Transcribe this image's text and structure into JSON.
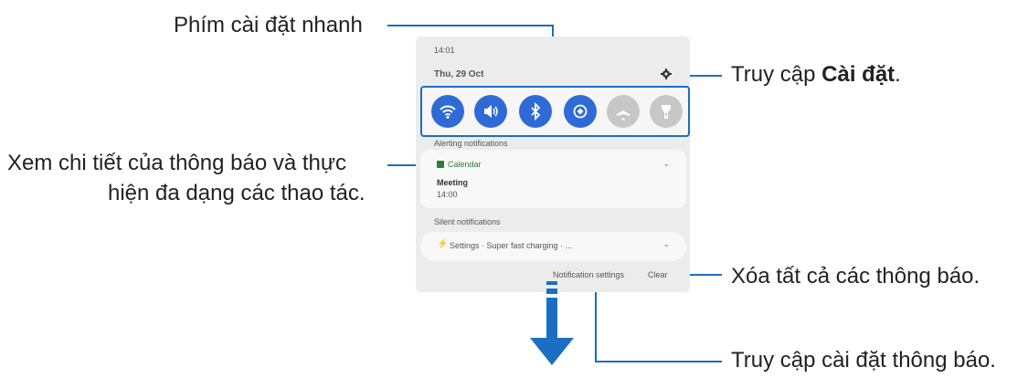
{
  "callouts": {
    "quick_settings": "Phím cài đặt nhanh",
    "settings_prefix": "Truy cập ",
    "settings_bold": "Cài đặt",
    "settings_suffix": ".",
    "details_line1": "Xem chi tiết của thông báo và thực",
    "details_line2": "hiện đa dạng các thao tác.",
    "clear_all": "Xóa tất cả các thông báo.",
    "notif_settings": "Truy cập cài đặt thông báo."
  },
  "phone": {
    "time": "14:01",
    "date": "Thu, 29 Oct",
    "quick_buttons": [
      {
        "icon": "wifi-icon",
        "state": "on"
      },
      {
        "icon": "sound-icon",
        "state": "on"
      },
      {
        "icon": "bluetooth-icon",
        "state": "on"
      },
      {
        "icon": "auto-rotate-icon",
        "state": "on"
      },
      {
        "icon": "airplane-icon",
        "state": "off"
      },
      {
        "icon": "flashlight-icon",
        "state": "off"
      }
    ],
    "alerting_header": "Alerting notifications",
    "calendar_app": "Calendar",
    "meeting_title": "Meeting",
    "meeting_time": "14:00",
    "silent_header": "Silent notifications",
    "silent_item": "Settings · Super fast charging · ...",
    "notification_settings": "Notification settings",
    "clear": "Clear"
  },
  "colors": {
    "accent": "#1b6ec2",
    "toggle_on": "#2f6bd6",
    "toggle_off": "#c7c7c7"
  }
}
